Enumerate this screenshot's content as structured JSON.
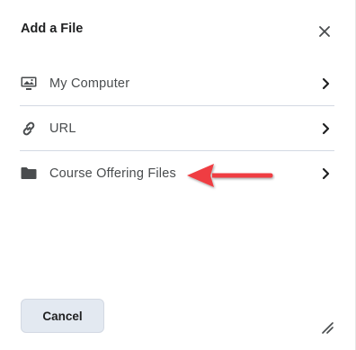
{
  "dialog": {
    "title": "Add a File",
    "close_icon": "close-icon"
  },
  "options": [
    {
      "label": "My Computer",
      "icon": "monitor-icon"
    },
    {
      "label": "URL",
      "icon": "link-icon"
    },
    {
      "label": "Course Offering Files",
      "icon": "folder-icon"
    }
  ],
  "footer": {
    "cancel_label": "Cancel"
  },
  "annotation": {
    "color": "#ef3e42",
    "points_to": "Course Offering Files"
  },
  "colors": {
    "text_primary": "#202122",
    "text_secondary": "#494c4e",
    "divider": "#d3d9e3",
    "button_bg": "#e3e9f1"
  }
}
